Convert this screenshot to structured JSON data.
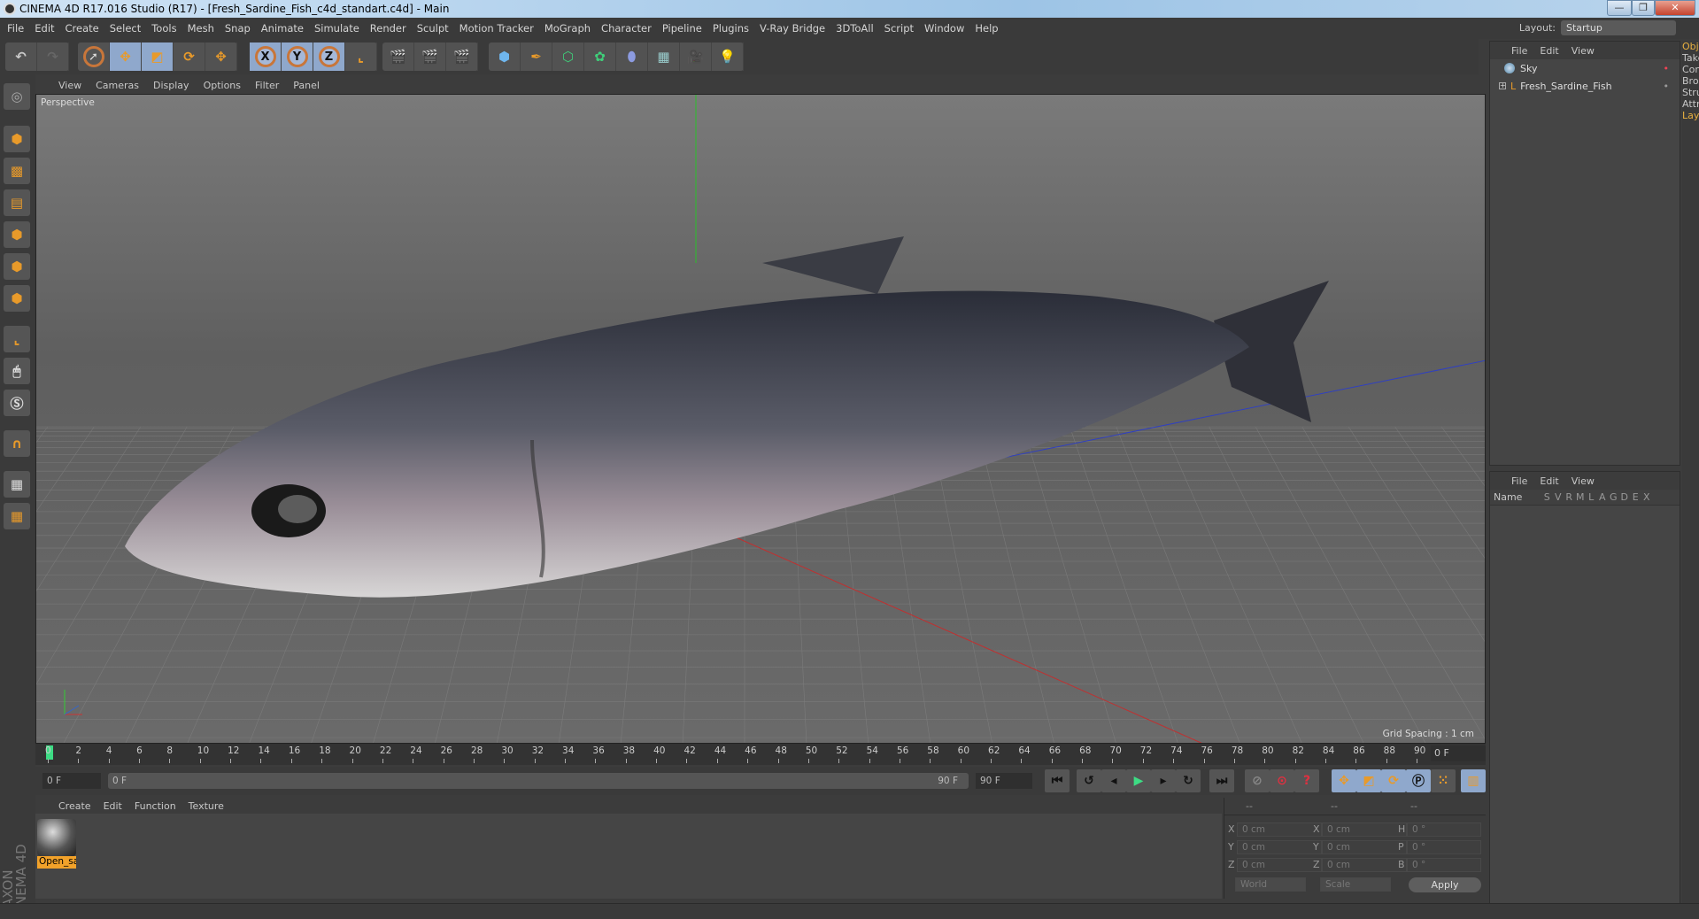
{
  "window": {
    "title": "CINEMA 4D R17.016 Studio (R17) - [Fresh_Sardine_Fish_c4d_standart.c4d] - Main",
    "min": "—",
    "max": "❐",
    "close": "✕"
  },
  "menu": [
    "File",
    "Edit",
    "Create",
    "Select",
    "Tools",
    "Mesh",
    "Snap",
    "Animate",
    "Simulate",
    "Render",
    "Sculpt",
    "Motion Tracker",
    "MoGraph",
    "Character",
    "Pipeline",
    "Plugins",
    "V-Ray Bridge",
    "3DToAll",
    "Script",
    "Window",
    "Help"
  ],
  "layout": {
    "label": "Layout:",
    "value": "Startup"
  },
  "toolbar": {
    "x": "X",
    "y": "Y",
    "z": "Z"
  },
  "viewport": {
    "menu": [
      "View",
      "Cameras",
      "Display",
      "Options",
      "Filter",
      "Panel"
    ],
    "label": "Perspective",
    "grid_spacing": "Grid Spacing : 1 cm"
  },
  "timeline": {
    "start": 0,
    "end": 90,
    "step": 2,
    "current_frame": "0 F"
  },
  "controls": {
    "start_field": "0 F",
    "range_start": "0 F",
    "range_end": "90 F",
    "end_field": "90 F"
  },
  "materials": {
    "menu": [
      "Create",
      "Edit",
      "Function",
      "Texture"
    ],
    "items": [
      {
        "name": "Open_sardine"
      }
    ]
  },
  "coordinates": {
    "headers": [
      "--",
      "--",
      "--"
    ],
    "rows": [
      {
        "a": "X",
        "av": "0 cm",
        "b": "X",
        "bv": "0 cm",
        "c": "H",
        "cv": "0 °"
      },
      {
        "a": "Y",
        "av": "0 cm",
        "b": "Y",
        "bv": "0 cm",
        "c": "P",
        "cv": "0 °"
      },
      {
        "a": "Z",
        "av": "0 cm",
        "b": "Z",
        "bv": "0 cm",
        "c": "B",
        "cv": "0 °"
      }
    ],
    "world": "World",
    "scale": "Scale",
    "apply": "Apply"
  },
  "objects": {
    "menu": [
      "File",
      "Edit",
      "View"
    ],
    "items": [
      {
        "name": "Sky"
      },
      {
        "name": "Fresh_Sardine_Fish"
      }
    ]
  },
  "layers": {
    "menu": [
      "File",
      "Edit",
      "View"
    ],
    "columns": [
      "Name",
      "S",
      "V",
      "R",
      "M",
      "L",
      "A",
      "G",
      "D",
      "E",
      "X"
    ]
  },
  "side_tabs": [
    "Objects",
    "Takes",
    "Content Browser",
    "Structure",
    "Attributes",
    "Layers"
  ],
  "brand": "MAXON CINEMA 4D",
  "colors": {
    "accent": "#f2a22a",
    "active_button": "#8fa8cc",
    "playhead": "#3ddc84"
  }
}
